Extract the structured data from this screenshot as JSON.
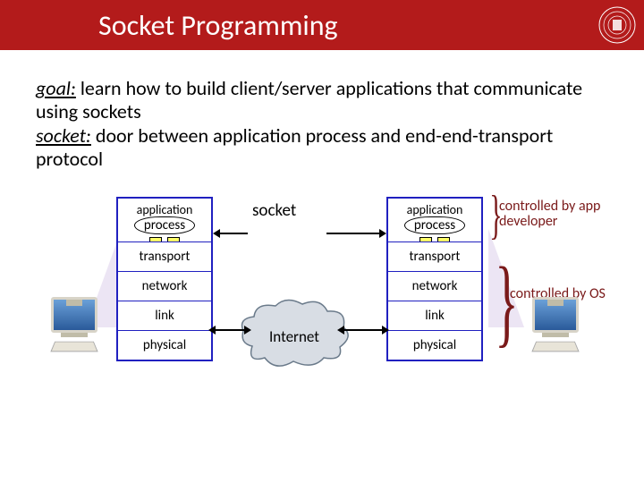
{
  "title": "Socket Programming",
  "goal_label": "goal:",
  "goal_text": " learn how to build client/server applications that communicate using sockets",
  "socket_label": "socket:",
  "socket_text": " door between application process and end-end-transport protocol",
  "stack": {
    "application": "application",
    "process": "process",
    "transport": "transport",
    "network": "network",
    "link": "link",
    "physical": "physical"
  },
  "center": {
    "socket": "socket",
    "internet": "Internet"
  },
  "annotations": {
    "app_dev": "controlled by app developer",
    "os": "controlled by OS"
  }
}
